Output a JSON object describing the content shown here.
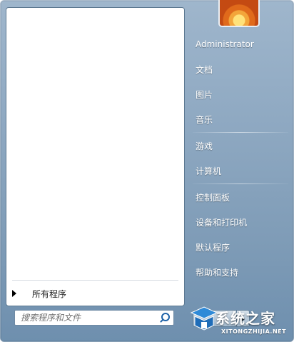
{
  "start_menu": {
    "left_pane": {
      "all_programs_label": "所有程序",
      "search": {
        "placeholder": "搜索程序和文件",
        "value": ""
      }
    },
    "right_pane": {
      "items": [
        {
          "label": "Administrator"
        },
        {
          "label": "文档"
        },
        {
          "label": "图片"
        },
        {
          "label": "音乐"
        },
        {
          "label": "游戏"
        },
        {
          "label": "计算机"
        },
        {
          "label": "控制面板"
        },
        {
          "label": "设备和打印机"
        },
        {
          "label": "默认程序"
        },
        {
          "label": "帮助和支持"
        }
      ]
    },
    "power": {
      "button_label": "",
      "arrow_icon": "triangle-right-icon"
    }
  },
  "watermark": {
    "brand_text": "系统之家",
    "url_text": "XITONGZHIJIA.NET"
  },
  "colors": {
    "frame_blue": "#8fa9c2",
    "pane_white": "#ffffff",
    "search_icon_blue": "#1f63a8",
    "text_dark": "#1e1e1e",
    "text_light": "#ffffff"
  }
}
